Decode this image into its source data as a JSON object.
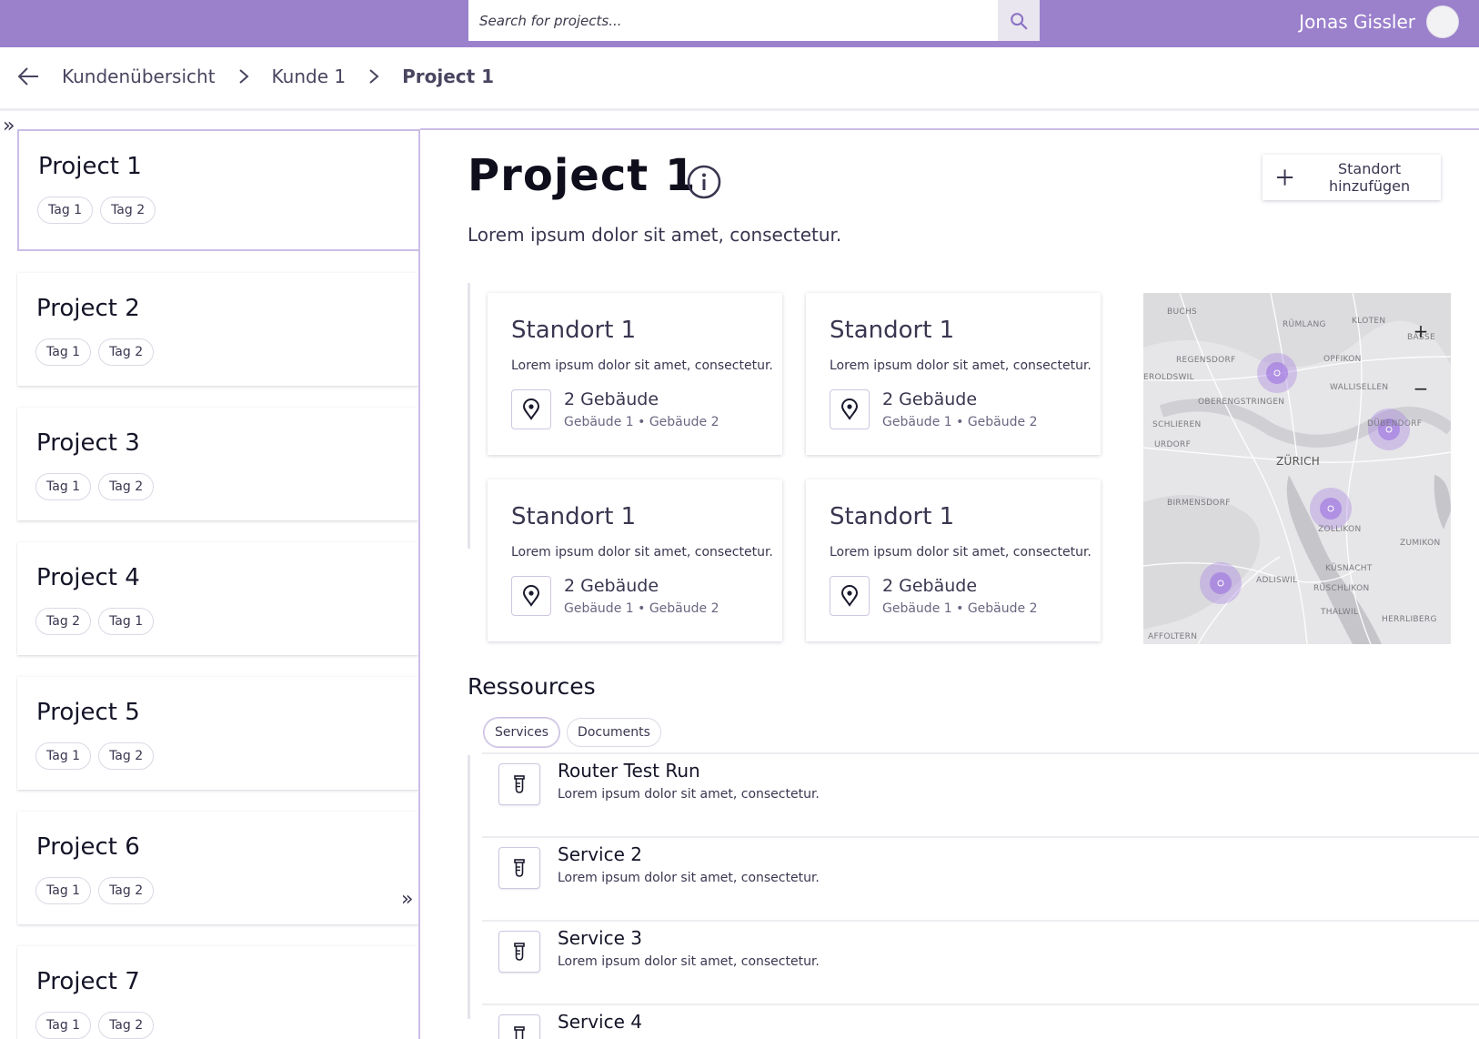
{
  "header": {
    "search_placeholder": "Search for projects...",
    "user_name": "Jonas Gissler"
  },
  "breadcrumb": {
    "items": [
      "Kundenübersicht",
      "Kunde 1",
      "Project 1"
    ]
  },
  "sidebar": {
    "projects": [
      {
        "title": "Project 1",
        "tags": [
          "Tag 1",
          "Tag 2"
        ]
      },
      {
        "title": "Project 2",
        "tags": [
          "Tag 1",
          "Tag 2"
        ]
      },
      {
        "title": "Project 3",
        "tags": [
          "Tag 1",
          "Tag 2"
        ]
      },
      {
        "title": "Project 4",
        "tags": [
          "Tag 2",
          "Tag 1"
        ]
      },
      {
        "title": "Project 5",
        "tags": [
          "Tag 1",
          "Tag 2"
        ]
      },
      {
        "title": "Project 6",
        "tags": [
          "Tag 1",
          "Tag 2"
        ]
      },
      {
        "title": "Project 7",
        "tags": [
          "Tag 1",
          "Tag 2"
        ]
      }
    ],
    "expand_glyph": "»"
  },
  "main": {
    "title": "Project 1",
    "description": "Lorem ipsum dolor sit amet, consectetur.",
    "add_location_label": "Standort hinzufügen",
    "locations": [
      {
        "title": "Standort 1",
        "description": "Lorem ipsum dolor sit amet, consectetur.",
        "count": "2 Gebäude",
        "buildings": "Gebäude 1 • Gebäude 2"
      },
      {
        "title": "Standort 1",
        "description": "Lorem ipsum dolor sit amet, consectetur.",
        "count": "2 Gebäude",
        "buildings": "Gebäude 1 • Gebäude 2"
      },
      {
        "title": "Standort 1",
        "description": "Lorem ipsum dolor sit amet, consectetur.",
        "count": "2 Gebäude",
        "buildings": "Gebäude 1 • Gebäude 2"
      },
      {
        "title": "Standort 1",
        "description": "Lorem ipsum dolor sit amet, consectetur.",
        "count": "2 Gebäude",
        "buildings": "Gebäude 1 • Gebäude 2"
      }
    ],
    "map": {
      "zoom_in": "+",
      "zoom_out": "−",
      "labels": [
        "BUCHS",
        "RÜMLANG",
        "KLOTEN",
        "BASSE",
        "REGENSDORF",
        "OPFIKON",
        "EROLDSWIL",
        "WALLISELLEN",
        "OBERENGSTRINGEN",
        "SCHLIEREN",
        "DÜBENDORF",
        "URDORF",
        "ZÜRICH",
        "BIRMENSDORF",
        "ZOLLIKON",
        "ZUMIKON",
        "ADLISWIL",
        "KÜSNACHT",
        "RÜSCHLIKON",
        "THALWIL",
        "HERRLIBERG",
        "AFFOLTERN"
      ],
      "marker_color": "#9b6fe0"
    },
    "resources": {
      "title": "Ressources",
      "tabs": [
        "Services",
        "Documents"
      ],
      "items": [
        {
          "name": "Router Test Run",
          "description": "Lorem ipsum dolor sit amet, consectetur."
        },
        {
          "name": "Service 2",
          "description": "Lorem ipsum dolor sit amet, consectetur."
        },
        {
          "name": "Service 3",
          "description": "Lorem ipsum dolor sit amet, consectetur."
        },
        {
          "name": "Service 4",
          "description": ""
        }
      ]
    }
  },
  "colors": {
    "brand": "#9b80cc",
    "accent_border": "#cbbde6",
    "text_dark": "#3a3650"
  }
}
